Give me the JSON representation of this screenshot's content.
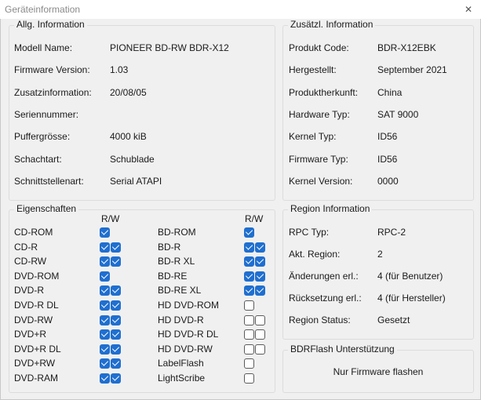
{
  "window": {
    "title": "Geräteinformation",
    "close_glyph": "✕"
  },
  "general": {
    "legend": "Allg. Information",
    "rows": [
      {
        "label": "Modell Name:",
        "value": "PIONEER  BD-RW   BDR-X12"
      },
      {
        "label": "Firmware Version:",
        "value": "1.03"
      },
      {
        "label": "Zusatzinformation:",
        "value": "20/08/05"
      },
      {
        "label": "Seriennummer:",
        "value": ""
      },
      {
        "label": "Puffergrösse:",
        "value": "4000 kiB"
      },
      {
        "label": "Schachtart:",
        "value": "Schublade"
      },
      {
        "label": "Schnittstellenart:",
        "value": "Serial ATAPI"
      }
    ]
  },
  "additional": {
    "legend": "Zusätzl. Information",
    "rows": [
      {
        "label": "Produkt Code:",
        "value": "BDR-X12EBK"
      },
      {
        "label": "Hergestellt:",
        "value": "September 2021"
      },
      {
        "label": "Produktherkunft:",
        "value": "China"
      },
      {
        "label": "Hardware Typ:",
        "value": "SAT 9000"
      },
      {
        "label": "Kernel Typ:",
        "value": "ID56"
      },
      {
        "label": "Firmware Typ:",
        "value": "ID56"
      },
      {
        "label": "Kernel Version:",
        "value": "0000"
      }
    ]
  },
  "properties": {
    "legend": "Eigenschaften",
    "rw_header": "R/W",
    "left": [
      {
        "name": "CD-ROM",
        "r": true,
        "w": null
      },
      {
        "name": "CD-R",
        "r": true,
        "w": true
      },
      {
        "name": "CD-RW",
        "r": true,
        "w": true
      },
      {
        "name": "DVD-ROM",
        "r": true,
        "w": null
      },
      {
        "name": "DVD-R",
        "r": true,
        "w": true
      },
      {
        "name": "DVD-R DL",
        "r": true,
        "w": true
      },
      {
        "name": "DVD-RW",
        "r": true,
        "w": true
      },
      {
        "name": "DVD+R",
        "r": true,
        "w": true
      },
      {
        "name": "DVD+R DL",
        "r": true,
        "w": true
      },
      {
        "name": "DVD+RW",
        "r": true,
        "w": true
      },
      {
        "name": "DVD-RAM",
        "r": true,
        "w": true
      }
    ],
    "right": [
      {
        "name": "BD-ROM",
        "r": true,
        "w": null
      },
      {
        "name": "BD-R",
        "r": true,
        "w": true
      },
      {
        "name": "BD-R XL",
        "r": true,
        "w": true
      },
      {
        "name": "BD-RE",
        "r": true,
        "w": true
      },
      {
        "name": "BD-RE XL",
        "r": true,
        "w": true
      },
      {
        "name": "HD DVD-ROM",
        "r": false,
        "w": null
      },
      {
        "name": "HD DVD-R",
        "r": false,
        "w": false
      },
      {
        "name": "HD DVD-R DL",
        "r": false,
        "w": false
      },
      {
        "name": "HD DVD-RW",
        "r": false,
        "w": false
      },
      {
        "name": "LabelFlash",
        "r": false,
        "w": null
      },
      {
        "name": "LightScribe",
        "r": false,
        "w": null
      }
    ]
  },
  "region": {
    "legend": "Region Information",
    "rows": [
      {
        "label": "RPC Typ:",
        "value": "RPC-2"
      },
      {
        "label": "Akt. Region:",
        "value": "2"
      },
      {
        "label": "Änderungen erl.:",
        "value": "4 (für Benutzer)"
      },
      {
        "label": "Rücksetzung erl.:",
        "value": "4 (für Hersteller)"
      },
      {
        "label": "Region Status:",
        "value": "Gesetzt"
      }
    ]
  },
  "bdrflash": {
    "legend": "BDRFlash Unterstützung",
    "text": "Nur Firmware flashen"
  }
}
